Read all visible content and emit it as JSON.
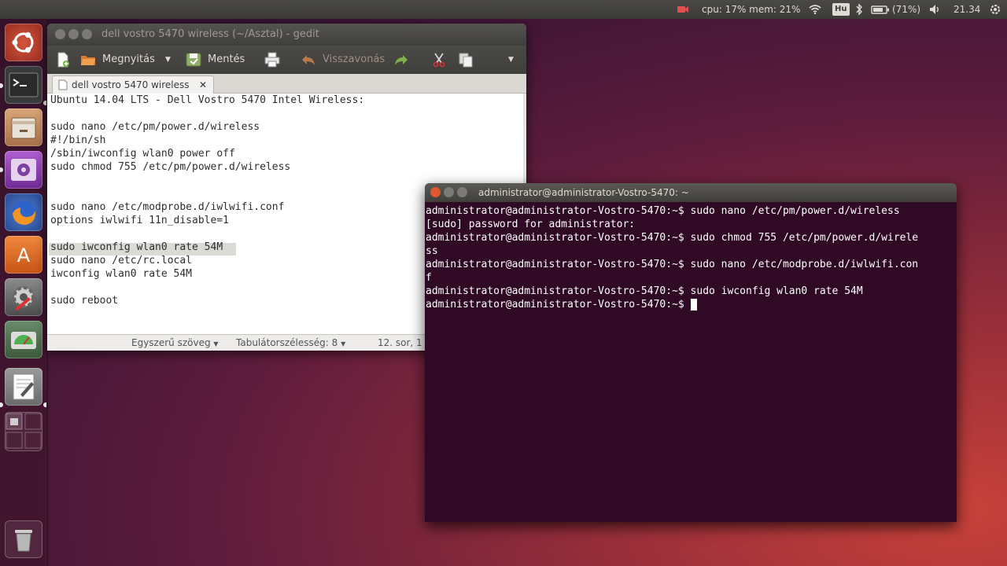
{
  "top_panel": {
    "cpu_mem": "cpu: 17% mem: 21%",
    "keyboard_layout": "Hu",
    "battery": "(71%)",
    "clock": "21.34",
    "accent": "#e05050"
  },
  "launcher": {
    "items": [
      {
        "name": "ubuntu-dash-icon"
      },
      {
        "name": "terminal-icon"
      },
      {
        "name": "files-icon"
      },
      {
        "name": "media-player-icon"
      },
      {
        "name": "firefox-icon"
      },
      {
        "name": "software-center-icon"
      },
      {
        "name": "system-settings-icon"
      },
      {
        "name": "disk-usage-icon"
      },
      {
        "name": "gedit-icon"
      },
      {
        "name": "workspace-switcher-icon"
      },
      {
        "name": "trash-icon"
      }
    ]
  },
  "gedit": {
    "title": "dell vostro 5470 wireless (~/Asztal) - gedit",
    "toolbar": {
      "open_label": "Megnyitás",
      "save_label": "Mentés",
      "undo_label": "Visszavonás"
    },
    "tab_label": "dell vostro 5470 wireless",
    "lines": [
      "Ubuntu 14.04 LTS - Dell Vostro 5470 Intel Wireless:",
      "",
      "sudo nano /etc/pm/power.d/wireless",
      "#!/bin/sh",
      "/sbin/iwconfig wlan0 power off",
      "sudo chmod 755 /etc/pm/power.d/wireless",
      "",
      "",
      "sudo nano /etc/modprobe.d/iwlwifi.conf",
      "options iwlwifi 11n_disable=1",
      "",
      "sudo iwconfig wlan0 rate 54M",
      "sudo nano /etc/rc.local",
      "iwconfig wlan0 rate 54M",
      "",
      "sudo reboot"
    ],
    "status": {
      "syntax": "Egyszerű szöveg",
      "tab_width": "Tabulátorszélesség: 8",
      "position": "12. sor, 1"
    }
  },
  "terminal": {
    "title": "administrator@administrator-Vostro-5470: ~",
    "lines": [
      "administrator@administrator-Vostro-5470:~$ sudo nano /etc/pm/power.d/wireless",
      "[sudo] password for administrator:",
      "administrator@administrator-Vostro-5470:~$ sudo chmod 755 /etc/pm/power.d/wirele",
      "ss",
      "administrator@administrator-Vostro-5470:~$ sudo nano /etc/modprobe.d/iwlwifi.con",
      "f",
      "administrator@administrator-Vostro-5470:~$ sudo iwconfig wlan0 rate 54M",
      "administrator@administrator-Vostro-5470:~$ "
    ]
  }
}
